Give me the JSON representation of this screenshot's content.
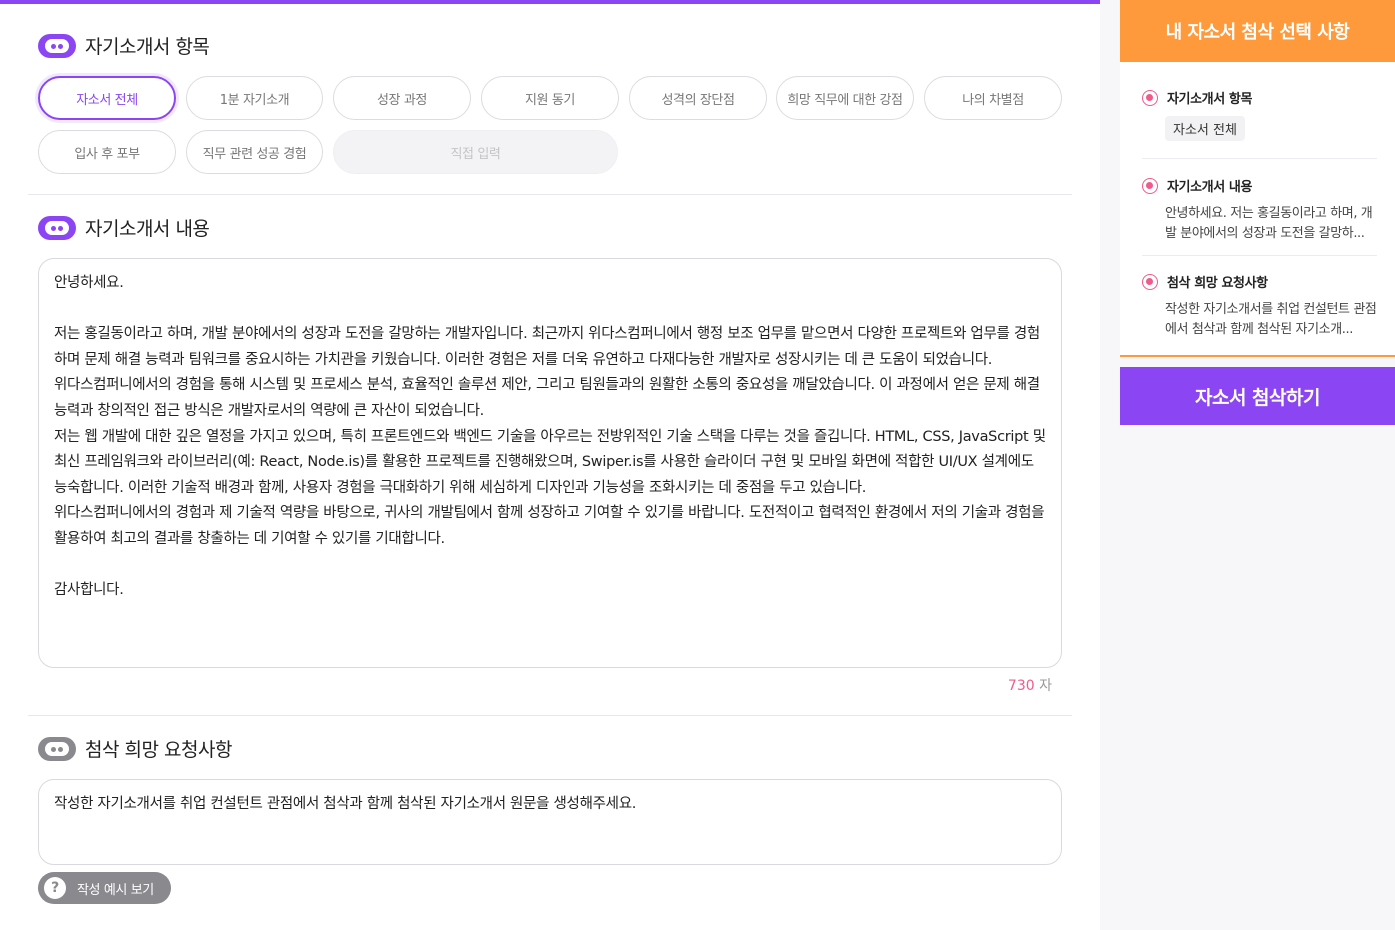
{
  "sections": {
    "items_title": "자기소개서 항목",
    "content_title": "자기소개서 내용",
    "request_title": "첨삭 희망 요청사항"
  },
  "chips": [
    {
      "label": "자소서 전체",
      "active": true
    },
    {
      "label": "1분 자기소개"
    },
    {
      "label": "성장 과정"
    },
    {
      "label": "지원 동기"
    },
    {
      "label": "성격의 장단점"
    },
    {
      "label": "희망 직무에 대한 강점"
    },
    {
      "label": "나의 차별점"
    },
    {
      "label": "입사 후 포부"
    },
    {
      "label": "직무 관련 성공 경험"
    }
  ],
  "custom_input": {
    "placeholder": "직접 입력"
  },
  "content_text": "안녕하세요.\n\n저는 홍길동이라고 하며, 개발 분야에서의 성장과 도전을 갈망하는 개발자입니다. 최근까지 위다스컴퍼니에서 행정 보조 업무를 맡으면서 다양한 프로젝트와 업무를 경험하며 문제 해결 능력과 팀워크를 중요시하는 가치관을 키웠습니다. 이러한 경험은 저를 더욱 유연하고 다재다능한 개발자로 성장시키는 데 큰 도움이 되었습니다.\n위다스컴퍼니에서의 경험을 통해 시스템 및 프로세스 분석, 효율적인 솔루션 제안, 그리고 팀원들과의 원활한 소통의 중요성을 깨달았습니다. 이 과정에서 얻은 문제 해결 능력과 창의적인 접근 방식은 개발자로서의 역량에 큰 자산이 되었습니다.\n저는 웹 개발에 대한 깊은 열정을 가지고 있으며, 특히 프론트엔드와 백엔드 기술을 아우르는 전방위적인 기술 스택을 다루는 것을 즐깁니다. HTML, CSS, JavaScript 및 최신 프레임워크와 라이브러리(예: React, Node.is)를 활용한 프로젝트를 진행해왔으며, Swiper.is를 사용한 슬라이더 구현 및 모바일 화면에 적합한 UI/UX 설계에도 능숙합니다. 이러한 기술적 배경과 함께, 사용자 경험을 극대화하기 위해 세심하게 디자인과 기능성을 조화시키는 데 중점을 두고 있습니다.\n위다스컴퍼니에서의 경험과 제 기술적 역량을 바탕으로, 귀사의 개발팀에서 함께 성장하고 기여할 수 있기를 바랍니다. 도전적이고 협력적인 환경에서 저의 기술과 경험을 활용하여 최고의 결과를 창출하는 데 기여할 수 있기를 기대합니다.\n\n감사합니다.",
  "counter": {
    "count": "730",
    "unit": "자"
  },
  "request_text": "작성한 자기소개서를 취업 컨설턴트 관점에서 첨삭과 함께 첨삭된 자기소개서 원문을 생성해주세요.",
  "example_button": {
    "icon": "?",
    "label": "작성 예시 보기"
  },
  "sidebar": {
    "header": "내 자소서 첨삭 선택 사항",
    "items": [
      {
        "title": "자기소개서 항목",
        "tag": "자소서 전체"
      },
      {
        "title": "자기소개서 내용",
        "text": "안녕하세요. 저는 홍길동이라고 하며, 개발 분야에서의 성장과 도전을 갈망하..."
      },
      {
        "title": "첨삭 희망 요청사항",
        "text": "작성한 자기소개서를 취업 컨설턴트 관점에서 첨삭과 함께 첨삭된 자기소개..."
      }
    ],
    "submit_label": "자소서 첨삭하기"
  },
  "colors": {
    "accent_purple": "#8b45f3",
    "accent_orange": "#ff9a3c",
    "accent_pink": "#f05b8a",
    "muted_gray": "#8a8a8e"
  }
}
